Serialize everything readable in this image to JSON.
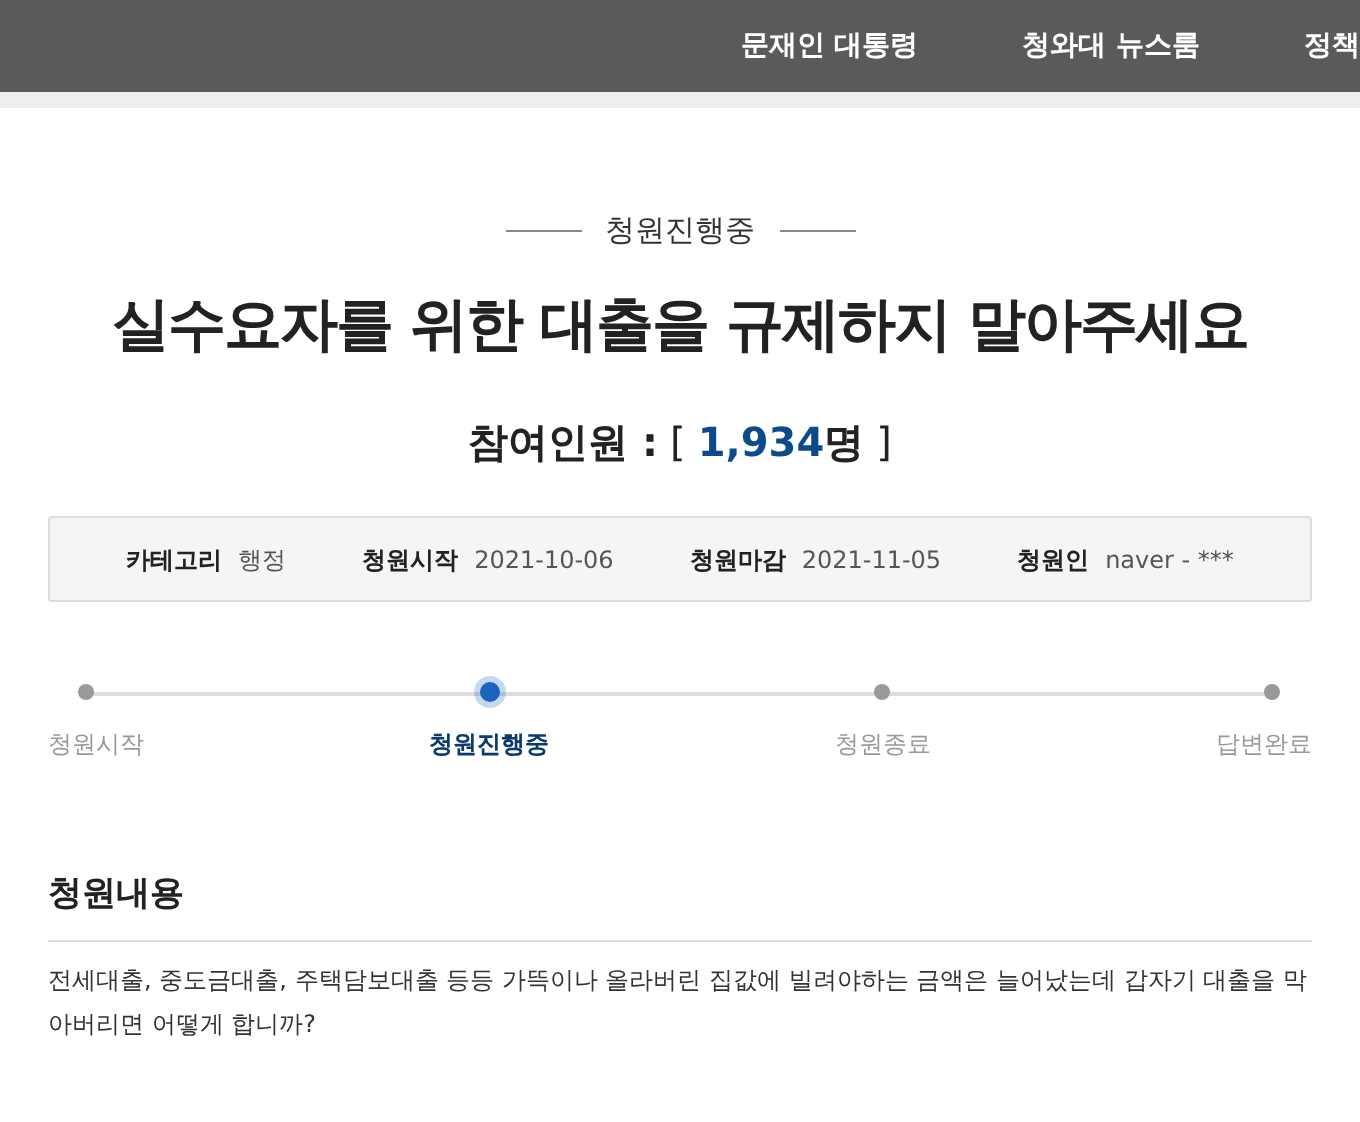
{
  "nav": [
    "문재인 대통령",
    "청와대 뉴스룸",
    "정책"
  ],
  "status": "청원진행중",
  "title": "실수요자를 위한 대출을 규제하지 말아주세요",
  "participants": {
    "label": "참여인원 :",
    "open": "[",
    "count": "1,934",
    "unit": "명",
    "close": "]"
  },
  "info": [
    {
      "label": "카테고리",
      "value": "행정"
    },
    {
      "label": "청원시작",
      "value": "2021-10-06"
    },
    {
      "label": "청원마감",
      "value": "2021-11-05"
    },
    {
      "label": "청원인",
      "value": "naver - ***"
    }
  ],
  "steps": [
    {
      "label": "청원시작",
      "selected": false
    },
    {
      "label": "청원진행중",
      "selected": true
    },
    {
      "label": "청원종료",
      "selected": false
    },
    {
      "label": "답변완료",
      "selected": false
    }
  ],
  "content": {
    "heading": "청원내용",
    "body": "전세대출, 중도금대출, 주택담보대출 등등 가뜩이나 올라버린 집값에 빌려야하는 금액은 늘어났는데 갑자기 대출을 막아버리면 어떻게 합니까?"
  }
}
